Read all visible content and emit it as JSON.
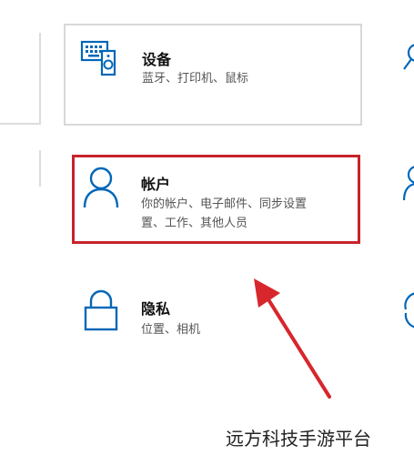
{
  "settings": {
    "devices": {
      "title": "设备",
      "desc": "蓝牙、打印机、鼠标",
      "icon": "keyboard-speaker-icon"
    },
    "accounts": {
      "title": "帐户",
      "desc_line1": "你的帐户、电子邮件、同步设置",
      "desc_line2": "置、工作、其他人员",
      "icon": "person-icon"
    },
    "privacy": {
      "title": "隐私",
      "desc": "位置、相机",
      "icon": "lock-icon"
    }
  },
  "annotation": {
    "highlight_color": "#c6232b",
    "arrow_color": "#d7262c"
  },
  "accent_color": "#0067b8",
  "watermark": "远方科技手游平台"
}
